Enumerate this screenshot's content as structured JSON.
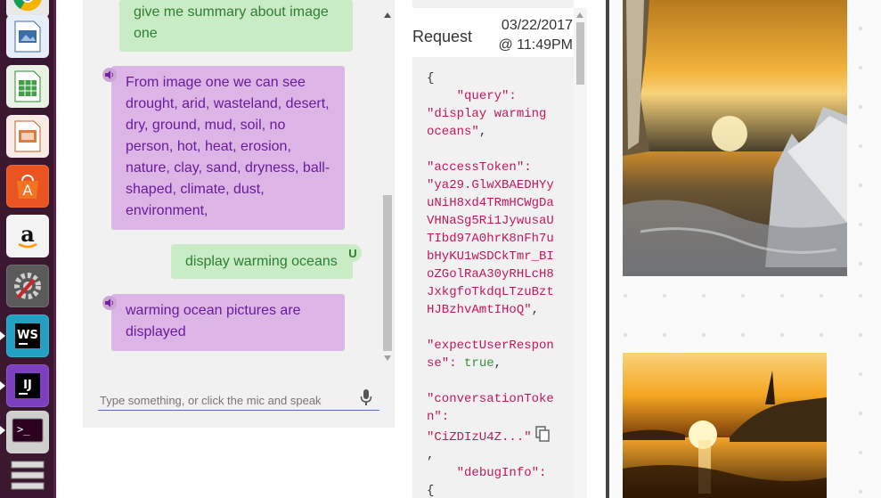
{
  "chat": {
    "messages": [
      {
        "role": "user",
        "text_lines": [
          "give me summary about image",
          "one"
        ]
      },
      {
        "role": "agent",
        "text_lines": [
          "From image one we can see",
          "drought, arid, wasteland, desert,",
          "dry, ground, mud, soil, no",
          "person, hot, heat, erosion,",
          "nature, clay, sand, dryness, ball-",
          "shaped, climate, dust,",
          "environment,"
        ]
      },
      {
        "role": "user",
        "text_lines": [
          "display warming oceans"
        ],
        "badge": "U"
      },
      {
        "role": "agent",
        "text_lines": [
          "warming ocean pictures are",
          "displayed"
        ]
      }
    ],
    "input_placeholder": "Type something, or click the mic and speak"
  },
  "debug": {
    "title": "Request",
    "date_line1": "03/22/2017",
    "date_line2": "@ 11:49PM"
  },
  "launcher": {
    "items": [
      "chrome",
      "libreoffice-draw",
      "libreoffice-calc",
      "libreoffice-impress",
      "ubuntu-software",
      "amazon",
      "system-settings",
      "webstorm",
      "intellij-idea",
      "terminal",
      "workspaces"
    ]
  },
  "colors": {
    "launcher_bg": "#3b1730",
    "agent_bubble": "#dcb5e6",
    "user_bubble": "#c9ecc6",
    "agent_text": "#6a1b9a",
    "user_text": "#2e7d32",
    "json_key": "#c2185b",
    "json_bool": "#388e3c"
  }
}
